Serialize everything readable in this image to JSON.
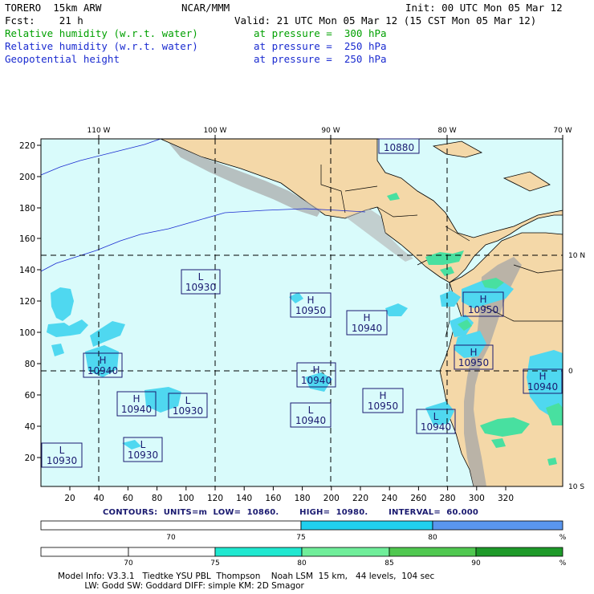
{
  "header": {
    "model": "TORERO  15km ARW",
    "org": "NCAR/MMM",
    "init": "Init: 00 UTC Mon 05 Mar 12",
    "fcst": "Fcst:    21 h",
    "valid": "Valid: 21 UTC Mon 05 Mar 12 (15 CST Mon 05 Mar 12)",
    "fields": [
      {
        "name": "Relative humidity (w.r.t. water)",
        "level": "at pressure =  300 hPa",
        "color": "#00a000"
      },
      {
        "name": "Relative humidity (w.r.t. water)",
        "level": "at pressure =  250 hPa",
        "color": "#1a2bd0"
      },
      {
        "name": "Geopotential height",
        "level": "at pressure =  250 hPa",
        "color": "#000000"
      }
    ]
  },
  "map": {
    "colors": {
      "ocean": "#d9fbfb",
      "land": "#f4d8a8",
      "mountain": "#9a9a9a",
      "rh_blue": "#4fd8f0",
      "rh_green": "#48e0a0"
    },
    "top_lon_labels": [
      "110 W",
      "100 W",
      "90 W",
      "80 W",
      "70 W"
    ],
    "right_lat_labels": [
      "10 N",
      "0",
      "10 S"
    ],
    "y_ticks": [
      "220",
      "200",
      "180",
      "160",
      "140",
      "120",
      "100",
      "80",
      "60",
      "40",
      "20"
    ],
    "x_ticks": [
      "20",
      "40",
      "60",
      "80",
      "100",
      "120",
      "140",
      "160",
      "180",
      "200",
      "220",
      "240",
      "260",
      "280",
      "300",
      "320"
    ],
    "centers": [
      {
        "type": "H",
        "value": "10880"
      },
      {
        "type": "L",
        "value": "10930"
      },
      {
        "type": "H",
        "value": "10950"
      },
      {
        "type": "H",
        "value": "10950"
      },
      {
        "type": "H",
        "value": "10940"
      },
      {
        "type": "H",
        "value": "10950"
      },
      {
        "type": "H",
        "value": "10940"
      },
      {
        "type": "H",
        "value": "10940"
      },
      {
        "type": "H",
        "value": "10940"
      },
      {
        "type": "H",
        "value": "10940"
      },
      {
        "type": "L",
        "value": "10930"
      },
      {
        "type": "L",
        "value": "10940"
      },
      {
        "type": "H",
        "value": "10950"
      },
      {
        "type": "L",
        "value": "10940"
      },
      {
        "type": "L",
        "value": "10930"
      },
      {
        "type": "L",
        "value": "10930"
      }
    ]
  },
  "contours": {
    "text": "CONTOURS:  UNITS=m  LOW=  10860.       HIGH=  10980.       INTERVAL=  60.000"
  },
  "legend_250": {
    "labels": [
      "70",
      "75",
      "80",
      "%"
    ],
    "colors": [
      "#ffffff",
      "#ffffff",
      "#20d0ee",
      "#5a96ee"
    ]
  },
  "legend_300": {
    "labels": [
      "70",
      "75",
      "80",
      "85",
      "90",
      "%"
    ],
    "colors": [
      "#ffffff",
      "#ffffff",
      "#ffffff",
      "#20e8d0",
      "#70ee9a",
      "#50c850",
      "#1e9a2a"
    ]
  },
  "footer": {
    "line1": "Model Info: V3.3.1   Tiedtke YSU PBL  Thompson    Noah LSM  15 km,   44 levels,  104 sec",
    "line2": "          LW: Godd SW: Goddard DIFF: simple KM: 2D Smagor"
  }
}
